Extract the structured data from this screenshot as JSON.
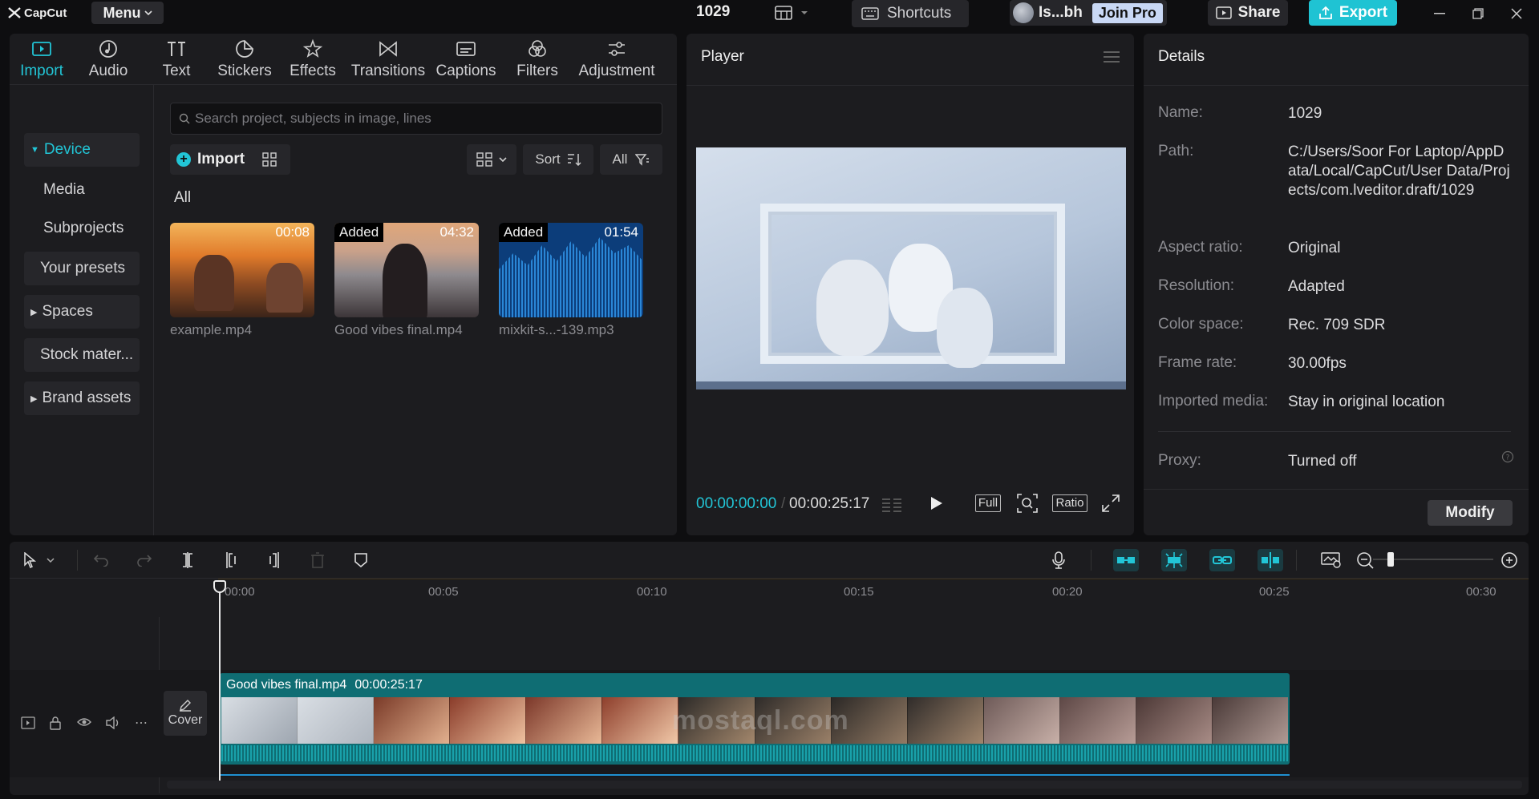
{
  "app": {
    "brand": "CapCut",
    "menu_label": "Menu",
    "project_name": "1029",
    "shortcuts_label": "Shortcuts",
    "user_name": "Is...bh",
    "join_pro_label": "Join Pro",
    "share_label": "Share",
    "export_label": "Export"
  },
  "tabs": [
    {
      "label": "Import",
      "icon": "import-icon",
      "active": true
    },
    {
      "label": "Audio",
      "icon": "audio-icon"
    },
    {
      "label": "Text",
      "icon": "text-icon"
    },
    {
      "label": "Stickers",
      "icon": "stickers-icon"
    },
    {
      "label": "Effects",
      "icon": "effects-icon"
    },
    {
      "label": "Transitions",
      "icon": "transitions-icon"
    },
    {
      "label": "Captions",
      "icon": "captions-icon"
    },
    {
      "label": "Filters",
      "icon": "filters-icon"
    },
    {
      "label": "Adjustment",
      "icon": "adjustment-icon"
    }
  ],
  "sidebar": {
    "items": [
      {
        "label": "Device"
      },
      {
        "label": "Media"
      },
      {
        "label": "Subprojects"
      },
      {
        "label": "Your presets"
      },
      {
        "label": "Spaces"
      },
      {
        "label": "Stock mater..."
      },
      {
        "label": "Brand assets"
      }
    ]
  },
  "media": {
    "search_placeholder": "Search project, subjects in image, lines",
    "import_label": "Import",
    "sort_label": "Sort",
    "filter_label": "All",
    "section_label": "All",
    "items": [
      {
        "name": "example.mp4",
        "badge": "",
        "duration": "00:08"
      },
      {
        "name": "Good vibes final.mp4",
        "badge": "Added",
        "duration": "04:32"
      },
      {
        "name": "mixkit-s...-139.mp3",
        "badge": "Added",
        "duration": "01:54"
      }
    ]
  },
  "player": {
    "title": "Player",
    "current_time": "00:00:00:00",
    "total_time": "00:00:25:17",
    "full_label": "Full",
    "ratio_label": "Ratio"
  },
  "details": {
    "title": "Details",
    "rows": [
      {
        "key": "Name:",
        "value": "1029"
      },
      {
        "key": "Path:",
        "value": "C:/Users/Soor For Laptop/AppData/Local/CapCut/User Data/Projects/com.lveditor.draft/1029"
      },
      {
        "key": "Aspect ratio:",
        "value": "Original"
      },
      {
        "key": "Resolution:",
        "value": "Adapted"
      },
      {
        "key": "Color space:",
        "value": "Rec. 709 SDR"
      },
      {
        "key": "Frame rate:",
        "value": "30.00fps"
      },
      {
        "key": "Imported media:",
        "value": "Stay in original location"
      },
      {
        "key": "Proxy:",
        "value": "Turned off"
      }
    ],
    "modify_label": "Modify"
  },
  "timeline": {
    "ruler_ticks": [
      "00:00",
      "00:05",
      "00:10",
      "00:15",
      "00:20",
      "00:25",
      "00:30"
    ],
    "cover_label": "Cover",
    "clip_name": "Good vibes final.mp4",
    "clip_duration": "00:00:25:17"
  },
  "watermark": "mostaql.com",
  "colors": {
    "accent": "#22c5d6",
    "export": "#1fc3d3",
    "clip": "#0f6d73",
    "panel": "#1c1c1f",
    "background": "#0e0e10"
  }
}
